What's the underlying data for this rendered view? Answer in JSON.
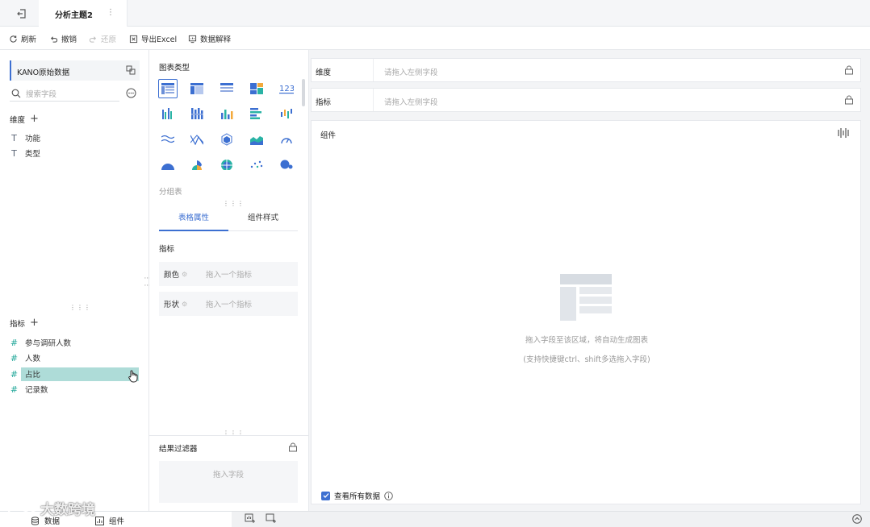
{
  "topbar": {
    "title": "分析主题2",
    "more": "⋮"
  },
  "toolbar": {
    "refresh": "刷新",
    "undo": "撤销",
    "redo": "还原",
    "export": "导出Excel",
    "explain": "数据解释"
  },
  "left": {
    "dataset": "KANO原始数据",
    "search_placeholder": "搜索字段",
    "dimension_title": "维度",
    "dimensions": [
      "功能",
      "类型"
    ],
    "metric_title": "指标",
    "metrics": [
      "参与调研人数",
      "人数",
      "占比",
      "记录数"
    ]
  },
  "middle": {
    "chart_type_label": "图表类型",
    "chart_type_name": "分组表",
    "tabs": [
      "表格属性",
      "组件样式"
    ],
    "metric_label": "指标",
    "slots": [
      {
        "label": "颜色",
        "placeholder": "拖入一个指标"
      },
      {
        "label": "形状",
        "placeholder": "拖入一个指标"
      }
    ],
    "filter_label": "结果过滤器",
    "filter_placeholder": "拖入字段"
  },
  "right": {
    "dimension_shelf": {
      "label": "维度",
      "placeholder": "请拖入左侧字段"
    },
    "metric_shelf": {
      "label": "指标",
      "placeholder": "请拖入左侧字段"
    },
    "canvas_title": "组件",
    "empty_main": "拖入字段至该区域，将自动生成图表",
    "empty_sub": "(支持快捷键ctrl、shift多选拖入字段)",
    "view_all": "查看所有数据"
  },
  "bottom": {
    "data_tab": "数据",
    "component_tab": "组件",
    "watermark": "大数跨境"
  },
  "colors": {
    "accent": "#3c6fd1",
    "teal": "#23a89a",
    "selected_field": "#aedcd8"
  }
}
